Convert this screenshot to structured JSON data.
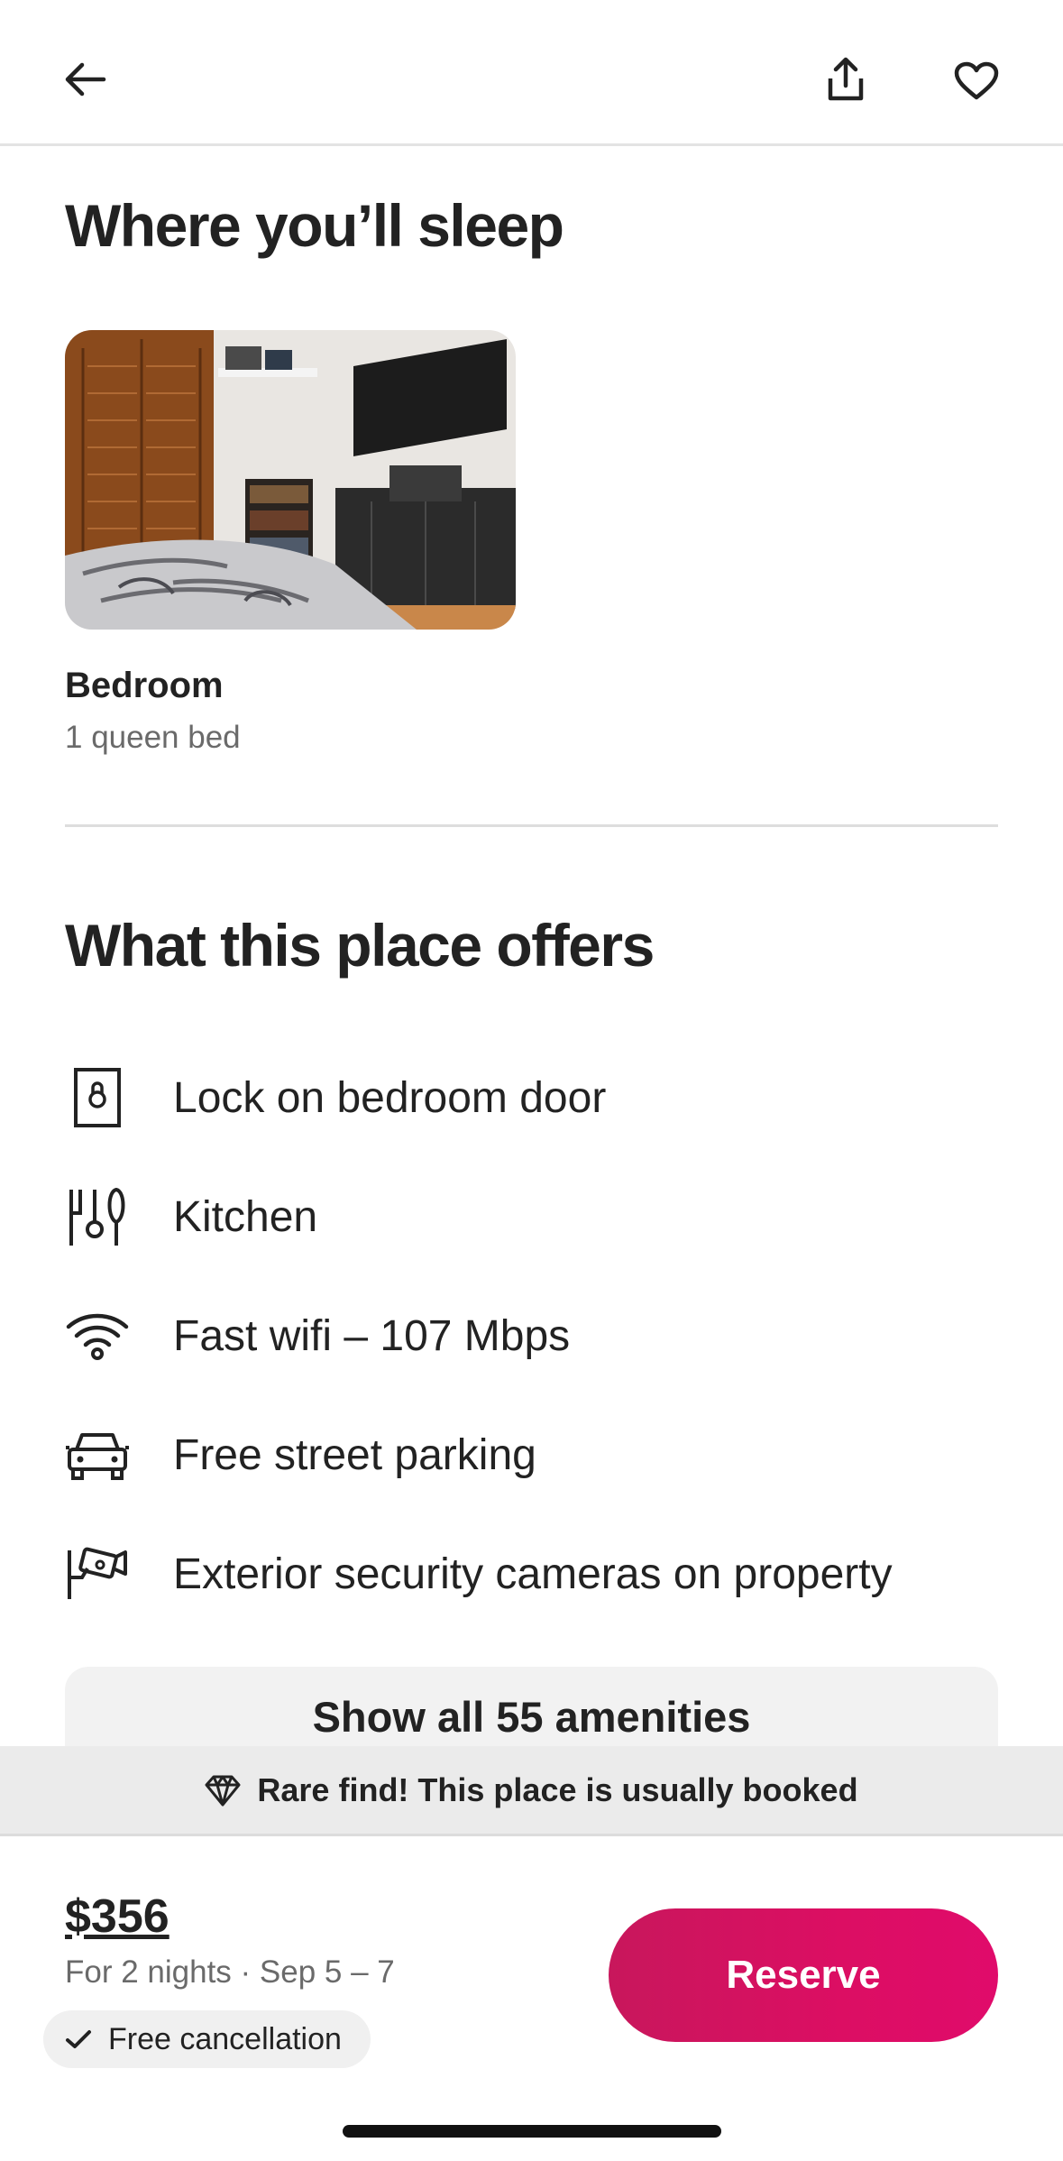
{
  "header": {
    "back_icon": "arrow-left-icon",
    "share_icon": "share-icon",
    "save_icon": "heart-icon"
  },
  "sleep": {
    "title": "Where you’ll sleep",
    "rooms": [
      {
        "name": "Bedroom",
        "beds": "1 queen bed"
      }
    ]
  },
  "offers": {
    "title": "What this place offers",
    "amenities": [
      {
        "label": "Lock on bedroom door",
        "icon": "lock-door-icon"
      },
      {
        "label": "Kitchen",
        "icon": "kitchen-utensils-icon"
      },
      {
        "label": "Fast wifi – 107 Mbps",
        "icon": "wifi-icon"
      },
      {
        "label": "Free street parking",
        "icon": "car-icon"
      },
      {
        "label": "Exterior security cameras on property",
        "icon": "security-camera-icon"
      }
    ],
    "show_all_label": "Show all 55 amenities"
  },
  "banner": {
    "text": "Rare find! This place is usually booked",
    "icon": "diamond-icon"
  },
  "footer": {
    "price": "$356",
    "dates": "For 2 nights · Sep 5 – 7",
    "cancellation": "Free cancellation",
    "reserve_label": "Reserve"
  },
  "colors": {
    "accent": "#DC0E63",
    "text": "#222222",
    "muted": "#6A6A6A"
  }
}
